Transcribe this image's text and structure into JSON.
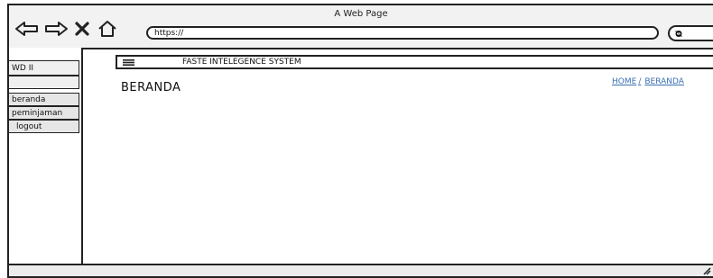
{
  "window": {
    "title": "A Web Page",
    "url": "https://"
  },
  "toolbar": {
    "icons": [
      "back-arrow-icon",
      "forward-arrow-icon",
      "close-icon",
      "home-icon",
      "search-icon"
    ]
  },
  "sidebar": {
    "brand": "WD II",
    "items": [
      {
        "label": "beranda"
      },
      {
        "label": "peminjaman"
      },
      {
        "label": "logout"
      }
    ]
  },
  "appbar": {
    "title": "FASTE INTELEGENCE SYSTEM"
  },
  "page": {
    "title": "BERANDA"
  },
  "breadcrumb": {
    "home": "HOME",
    "separator": "/",
    "current": "BERANDA"
  }
}
